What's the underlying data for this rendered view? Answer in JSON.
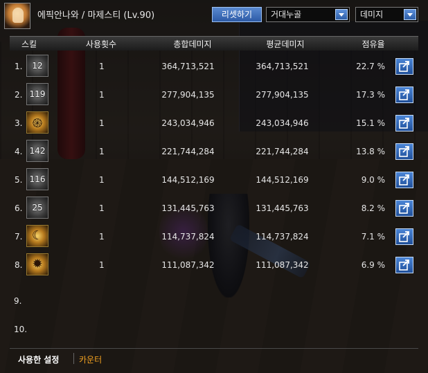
{
  "header": {
    "character": "에픽안나와 / 마제스티 (Lv.90)",
    "reset_label": "리셋하기",
    "mode_select": "거대누골",
    "sort_select": "데미지"
  },
  "table": {
    "columns": [
      "스킬",
      "사용횟수",
      "총합데미지",
      "평균데미지",
      "점유율"
    ],
    "rows": [
      {
        "rank": "1.",
        "skill_level": "12",
        "skill_icon": "slash-skill-icon",
        "uses": "1",
        "total": "364,713,521",
        "avg": "364,713,521",
        "share": "22.7 %"
      },
      {
        "rank": "2.",
        "skill_level": "119",
        "skill_icon": "blade-skill-icon",
        "uses": "1",
        "total": "277,904,135",
        "avg": "277,904,135",
        "share": "17.3 %"
      },
      {
        "rank": "3.",
        "skill_level": "",
        "skill_icon": "vortex-skill-icon",
        "uses": "1",
        "total": "243,034,946",
        "avg": "243,034,946",
        "share": "15.1 %"
      },
      {
        "rank": "4.",
        "skill_level": "142",
        "skill_icon": "strike-skill-icon",
        "uses": "1",
        "total": "221,744,284",
        "avg": "221,744,284",
        "share": "13.8 %"
      },
      {
        "rank": "5.",
        "skill_level": "116",
        "skill_icon": "wave-skill-icon",
        "uses": "1",
        "total": "144,512,169",
        "avg": "144,512,169",
        "share": "9.0 %"
      },
      {
        "rank": "6.",
        "skill_level": "25",
        "skill_icon": "cross-skill-icon",
        "uses": "1",
        "total": "131,445,763",
        "avg": "131,445,763",
        "share": "8.2 %"
      },
      {
        "rank": "7.",
        "skill_level": "",
        "skill_icon": "moon-skill-icon",
        "uses": "1",
        "total": "114,737,824",
        "avg": "114,737,824",
        "share": "7.1 %"
      },
      {
        "rank": "8.",
        "skill_level": "",
        "skill_icon": "burst-skill-icon",
        "uses": "1",
        "total": "111,087,342",
        "avg": "111,087,342",
        "share": "6.9 %"
      }
    ],
    "empty_ranks": [
      "9.",
      "10."
    ]
  },
  "tabs": {
    "active": "사용한 설정",
    "inactive": "카운터"
  },
  "colors": {
    "accent_blue": "#2c5aa6",
    "tab_orange": "#f0a020"
  }
}
